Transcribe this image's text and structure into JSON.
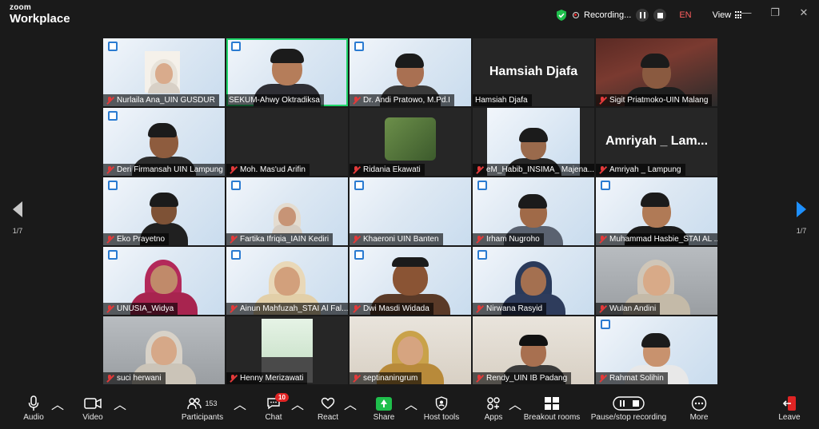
{
  "app": {
    "brand_top": "zoom",
    "brand_bottom": "Workplace"
  },
  "status": {
    "recording_label": "Recording...",
    "language": "EN",
    "view_label": "View"
  },
  "window_controls": {
    "minimize": "—",
    "restore": "❐",
    "close": "✕"
  },
  "pagination": {
    "left": "1/7",
    "right": "1/7"
  },
  "colors": {
    "active_speaker": "#1fd66a",
    "muted_icon": "#e23a3a",
    "share": "#1fbf4c",
    "leave": "#e02424",
    "nav_next": "#1e90ff"
  },
  "tiles": [
    {
      "name": "Nurlaila Ana_UIN GUSDUR",
      "muted": true
    },
    {
      "name": "SEKUM-Ahwy Oktradiksa",
      "muted": false,
      "active": true
    },
    {
      "name": "Dr. Andi Pratowo, M.Pd.I",
      "muted": true
    },
    {
      "name": "Hamsiah Djafa",
      "muted": false,
      "big_name": "Hamsiah Djafa"
    },
    {
      "name": "Sigit Priatmoko-UIN Malang",
      "muted": true
    },
    {
      "name": "Deri Firmansah UIN Lampung",
      "muted": true
    },
    {
      "name": "Moh. Mas'ud Arifin",
      "muted": true
    },
    {
      "name": "Ridania Ekawati",
      "muted": true
    },
    {
      "name": "eM_Habib_INSIMA_ Majena...",
      "muted": true
    },
    {
      "name": "Amriyah _ Lampung",
      "muted": true,
      "big_name": "Amriyah _ Lam..."
    },
    {
      "name": "Eko Prayetno",
      "muted": true
    },
    {
      "name": "Fartika Ifriqia_IAIN Kediri",
      "muted": true
    },
    {
      "name": "Khaeroni UIN Banten",
      "muted": true
    },
    {
      "name": "Irham Nugroho",
      "muted": true
    },
    {
      "name": "Muhammad Hasbie_STAI AL ...",
      "muted": true
    },
    {
      "name": "UNUSIA_Widya",
      "muted": true
    },
    {
      "name": "Ainun Mahfuzah_STAI Al Fal...",
      "muted": true
    },
    {
      "name": "Dwi Masdi Widada",
      "muted": true
    },
    {
      "name": "Nirwana Rasyid",
      "muted": true
    },
    {
      "name": "Wulan Andini",
      "muted": true
    },
    {
      "name": "suci herwani",
      "muted": true
    },
    {
      "name": "Henny Merizawati",
      "muted": true
    },
    {
      "name": "septinaningrum",
      "muted": true
    },
    {
      "name": "Rendy_UIN IB Padang",
      "muted": true
    },
    {
      "name": "Rahmat Solihin",
      "muted": true
    }
  ],
  "toolbar": {
    "audio": "Audio",
    "video": "Video",
    "participants": "Participants",
    "participants_count": "153",
    "chat": "Chat",
    "chat_badge": "10",
    "react": "React",
    "share": "Share",
    "host_tools": "Host tools",
    "apps": "Apps",
    "breakout_rooms": "Breakout rooms",
    "pause_stop_recording": "Pause/stop recording",
    "more": "More",
    "leave": "Leave"
  }
}
